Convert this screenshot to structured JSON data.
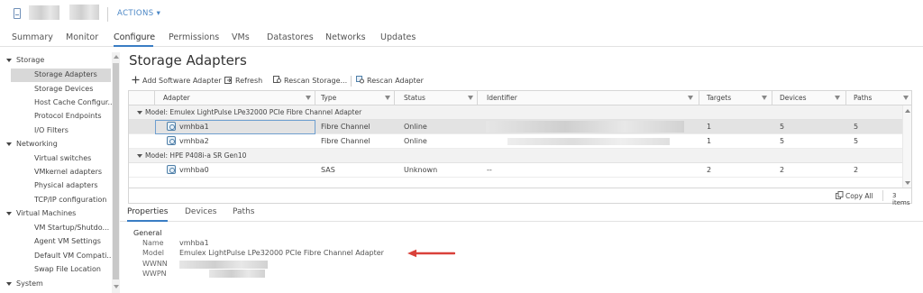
{
  "header": {
    "actions_label": "ACTIONS ▾"
  },
  "tabs": [
    {
      "label": "Summary"
    },
    {
      "label": "Monitor"
    },
    {
      "label": "Configure"
    },
    {
      "label": "Permissions"
    },
    {
      "label": "VMs"
    },
    {
      "label": "Datastores"
    },
    {
      "label": "Networks"
    },
    {
      "label": "Updates"
    }
  ],
  "active_tab": "Configure",
  "nav": {
    "groups": [
      {
        "label": "Storage",
        "items": [
          "Storage Adapters",
          "Storage Devices",
          "Host Cache Configur...",
          "Protocol Endpoints",
          "I/O Filters"
        ]
      },
      {
        "label": "Networking",
        "items": [
          "Virtual switches",
          "VMkernel adapters",
          "Physical adapters",
          "TCP/IP configuration"
        ]
      },
      {
        "label": "Virtual Machines",
        "items": [
          "VM Startup/Shutdo...",
          "Agent VM Settings",
          "Default VM Compati...",
          "Swap File Location"
        ]
      },
      {
        "label": "System",
        "items": []
      }
    ],
    "selected": "Storage Adapters"
  },
  "main": {
    "title": "Storage Adapters",
    "toolbar": {
      "add": "Add Software Adapter",
      "refresh": "Refresh",
      "rescan_storage": "Rescan Storage...",
      "rescan_adapter": "Rescan Adapter"
    },
    "grid": {
      "columns": [
        "Adapter",
        "Type",
        "Status",
        "Identifier",
        "Targets",
        "Devices",
        "Paths"
      ],
      "groups": [
        {
          "label": "Model: Emulex LightPulse LPe32000 PCIe Fibre Channel Adapter",
          "rows": [
            {
              "adapter": "vmhba1",
              "type": "Fibre Channel",
              "status": "Online",
              "identifier": "",
              "targets": "1",
              "devices": "5",
              "paths": "5"
            },
            {
              "adapter": "vmhba2",
              "type": "Fibre Channel",
              "status": "Online",
              "identifier": "",
              "targets": "1",
              "devices": "5",
              "paths": "5"
            }
          ]
        },
        {
          "label": "Model: HPE P408i-a SR Gen10",
          "rows": [
            {
              "adapter": "vmhba0",
              "type": "SAS",
              "status": "Unknown",
              "identifier": "--",
              "targets": "2",
              "devices": "2",
              "paths": "2"
            }
          ]
        }
      ],
      "footer": {
        "copy_all": "Copy All",
        "count": "3 items"
      }
    },
    "detail_tabs": [
      "Properties",
      "Devices",
      "Paths"
    ],
    "active_detail_tab": "Properties",
    "properties": {
      "heading": "General",
      "name_label": "Name",
      "name_value": "vmhba1",
      "model_label": "Model",
      "model_value": "Emulex LightPulse LPe32000 PCIe Fibre Channel Adapter",
      "wwnn_label": "WWNN",
      "wwpn_label": "WWPN"
    }
  },
  "colors": {
    "accent": "#3a7dc4",
    "arrow": "#d9413a"
  }
}
